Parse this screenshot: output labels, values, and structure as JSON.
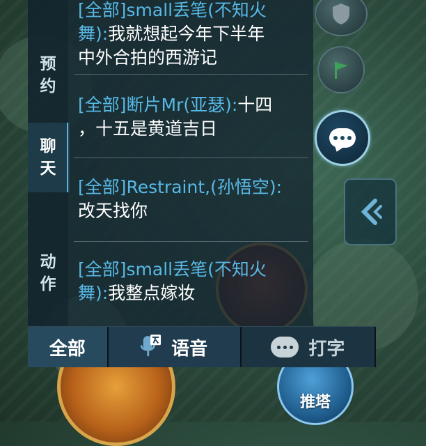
{
  "tabs": [
    {
      "label_line1": "预",
      "label_line2": "约"
    },
    {
      "label_line1": "聊",
      "label_line2": "天"
    },
    {
      "label_line1": "动",
      "label_line2": "作"
    }
  ],
  "messages": [
    {
      "sender_line": "[全部]small丢笔(不知火",
      "sender_cont": "舞):",
      "text": "我就想起今年下半年",
      "text2": "中外合拍的西游记"
    },
    {
      "sender": "[全部]断片Mr(亚瑟):",
      "text": "十四",
      "text2": "，十五是黄道吉日"
    },
    {
      "sender": "[全部]Restraint,(孙悟空):",
      "text2": "改天找你"
    },
    {
      "sender_line": "[全部]small丢笔(不知火",
      "sender_cont": "舞):",
      "text": "我整点嫁妆"
    }
  ],
  "bottom_bar": {
    "all_label": "全部",
    "voice_label": "语音",
    "type_label": "打字"
  },
  "hud": {
    "push_tower_label": "推塔"
  },
  "colors": {
    "sender": "#58b9e6",
    "accent": "#5fb6de"
  }
}
